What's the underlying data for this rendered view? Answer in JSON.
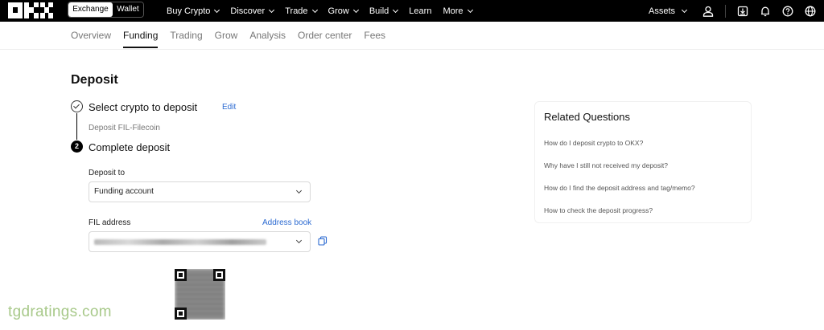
{
  "topbar": {
    "logo": "OKX",
    "mode": {
      "exchange": "Exchange",
      "wallet": "Wallet"
    },
    "nav": [
      "Buy Crypto",
      "Discover",
      "Trade",
      "Grow",
      "Build",
      "Learn",
      "More"
    ],
    "nav_dropdown": [
      true,
      true,
      true,
      true,
      true,
      false,
      true
    ],
    "assets": "Assets",
    "icons": [
      "user-icon",
      "download-icon",
      "bell-icon",
      "help-icon",
      "globe-icon"
    ]
  },
  "subnav": {
    "tabs": [
      "Overview",
      "Funding",
      "Trading",
      "Grow",
      "Analysis",
      "Order center",
      "Fees"
    ],
    "active": "Funding"
  },
  "deposit": {
    "title": "Deposit",
    "step1_title": "Select crypto to deposit",
    "edit": "Edit",
    "step1_sub": "Deposit FIL-Filecoin",
    "step2_num": "2",
    "step2_title": "Complete deposit",
    "deposit_to_label": "Deposit to",
    "deposit_to_value": "Funding account",
    "address_label": "FIL address",
    "address_book": "Address book"
  },
  "related": {
    "title": "Related Questions",
    "questions": [
      "How do I deposit crypto to OKX?",
      "Why have I still not received my deposit?",
      "How do I find the deposit address and tag/memo?",
      "How to check the deposit progress?"
    ]
  },
  "watermark": "tgdratings.com",
  "colors": {
    "link": "#2b6ad1",
    "topbar_bg": "#000000",
    "watermark": "#a8c98a"
  }
}
